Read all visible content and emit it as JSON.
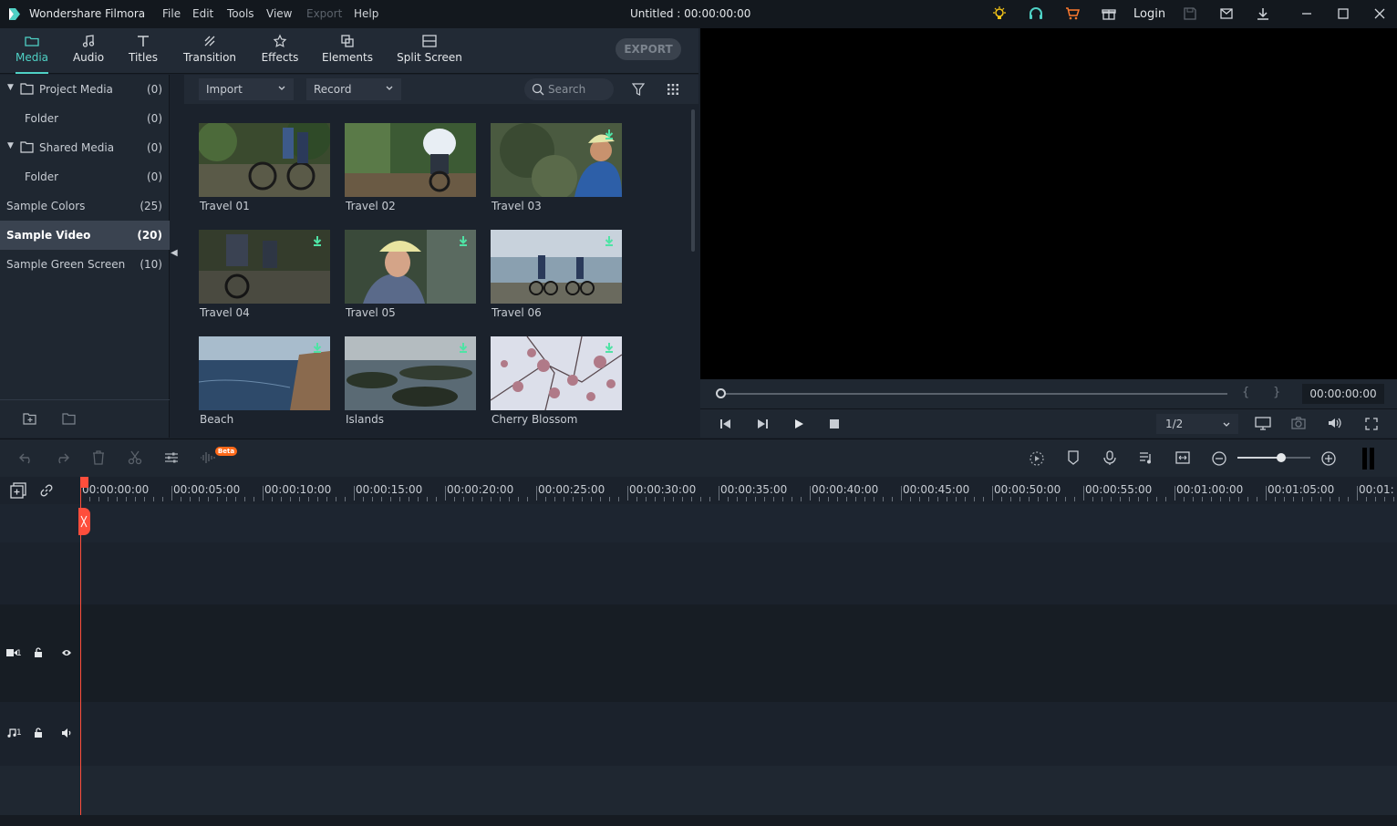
{
  "app": {
    "name": "Wondershare Filmora",
    "doc_title": "Untitled : 00:00:00:00",
    "menus": [
      "File",
      "Edit",
      "Tools",
      "View",
      "Export",
      "Help"
    ],
    "login": "Login",
    "accent": "#4fd1c5"
  },
  "tabs": [
    {
      "label": "Media",
      "icon": "folder-icon",
      "active": true
    },
    {
      "label": "Audio",
      "icon": "music-note-icon"
    },
    {
      "label": "Titles",
      "icon": "text-t-icon"
    },
    {
      "label": "Transition",
      "icon": "transition-icon"
    },
    {
      "label": "Effects",
      "icon": "effects-star-icon"
    },
    {
      "label": "Elements",
      "icon": "elements-icon"
    },
    {
      "label": "Split Screen",
      "icon": "split-screen-icon"
    }
  ],
  "export_label": "EXPORT",
  "sidebar": {
    "items": [
      {
        "label": "Project Media",
        "count": "(0)"
      },
      {
        "label": "Folder",
        "count": "(0)"
      },
      {
        "label": "Shared Media",
        "count": "(0)"
      },
      {
        "label": "Folder",
        "count": "(0)"
      },
      {
        "label": "Sample Colors",
        "count": "(25)"
      },
      {
        "label": "Sample Video",
        "count": "(20)",
        "active": true
      },
      {
        "label": "Sample Green Screen",
        "count": "(10)"
      }
    ]
  },
  "media_toolbar": {
    "import": "Import",
    "record": "Record",
    "search_placeholder": "Search"
  },
  "clips": [
    {
      "label": "Travel 01"
    },
    {
      "label": "Travel 02"
    },
    {
      "label": "Travel 03"
    },
    {
      "label": "Travel 04"
    },
    {
      "label": "Travel 05"
    },
    {
      "label": "Travel 06"
    },
    {
      "label": "Beach"
    },
    {
      "label": "Islands"
    },
    {
      "label": "Cherry Blossom"
    }
  ],
  "preview": {
    "timecode": "00:00:00:00",
    "ratio": "1/2",
    "mark_in": "{",
    "mark_out": "}"
  },
  "ruler": {
    "labels": [
      "00:00:00:00",
      "00:00:05:00",
      "00:00:10:00",
      "00:00:15:00",
      "00:00:20:00",
      "00:00:25:00",
      "00:00:30:00",
      "00:00:35:00",
      "00:00:40:00",
      "00:00:45:00",
      "00:00:50:00",
      "00:00:55:00",
      "00:01:00:00",
      "00:01:05:00",
      "00:01:"
    ]
  },
  "timeline": {
    "video_track": "1",
    "audio_track": "1",
    "beta_badge": "Beta",
    "zoom_level": 0.6
  }
}
